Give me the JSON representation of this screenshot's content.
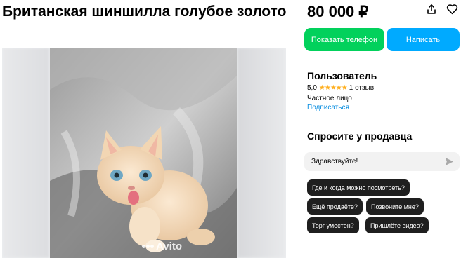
{
  "listing": {
    "title": "Британская шиншилла голубое золото",
    "price": "80 000 ₽",
    "watermark": "Avito"
  },
  "actions": {
    "show_phone": "Показать телефон",
    "write": "Написать"
  },
  "seller": {
    "name": "Пользователь",
    "rating": "5,0",
    "stars": "★★★★★",
    "reviews": "1 отзыв",
    "type": "Частное лицо",
    "subscribe": "Подписаться"
  },
  "ask": {
    "title": "Спросите у продавца",
    "message_value": "Здравствуйте!",
    "chips": [
      "Где и когда можно посмотреть?",
      "Ещё продаёте?",
      "Позвоните мне?",
      "Торг уместен?",
      "Пришлёте видео?"
    ]
  },
  "icons": [
    "share-icon",
    "heart-icon",
    "send-icon",
    "avito-logo-icon"
  ],
  "colors": {
    "phone_button": "#02d15c",
    "write_button": "#00aaff",
    "link": "#0a8ee0",
    "stars": "#ffb021",
    "chip_bg": "#1f1f1f"
  }
}
